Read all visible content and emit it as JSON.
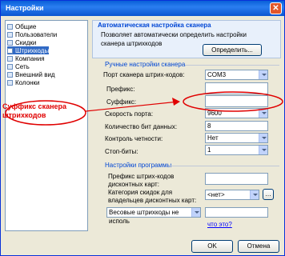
{
  "window": {
    "title": "Настройки",
    "close_label": "✕"
  },
  "sidebar": {
    "items": [
      {
        "label": "Общие"
      },
      {
        "label": "Пользователи"
      },
      {
        "label": "Скидки"
      },
      {
        "label": "Штрихкоды"
      },
      {
        "label": "Компания"
      },
      {
        "label": "Сеть"
      },
      {
        "label": "Внешний вид"
      },
      {
        "label": "Колонки"
      }
    ],
    "selected_index": 3
  },
  "auto_section": {
    "title": "Автоматическая настройка сканера",
    "description": "Позволяет автоматически определить настройки сканера штрихкодов",
    "button": "Определить..."
  },
  "manual_section": {
    "title": "Ручные настройки сканера",
    "port_label": "Порт сканера штрих-кодов:",
    "port_value": "COM3",
    "prefix_label": "Префикс:",
    "prefix_value": "",
    "suffix_label": "Суффикс:",
    "suffix_value": "",
    "speed_label": "Скорость порта:",
    "speed_value": "9600",
    "bits_label": "Количество бит данных:",
    "bits_value": "8",
    "parity_label": "Контроль четности:",
    "parity_value": "Нет",
    "stopbits_label": "Стоп-биты:",
    "stopbits_value": "1"
  },
  "program_section": {
    "title": "Настройки программы",
    "discount_prefix_label": "Префикс штрих-кодов дисконтных карт:",
    "discount_prefix_value": "",
    "discount_category_label": "Категория скидок для владельцев дисконтных карт:",
    "discount_category_value": "<нет>",
    "weight_combo_value": "Весовые штрихкоды не исполь",
    "weight_field_value": "",
    "link": "что это?"
  },
  "annotation": {
    "text": "Суффикс сканера штрихкодов"
  },
  "footer": {
    "ok_label": "OK",
    "cancel_label": "Отмена"
  }
}
